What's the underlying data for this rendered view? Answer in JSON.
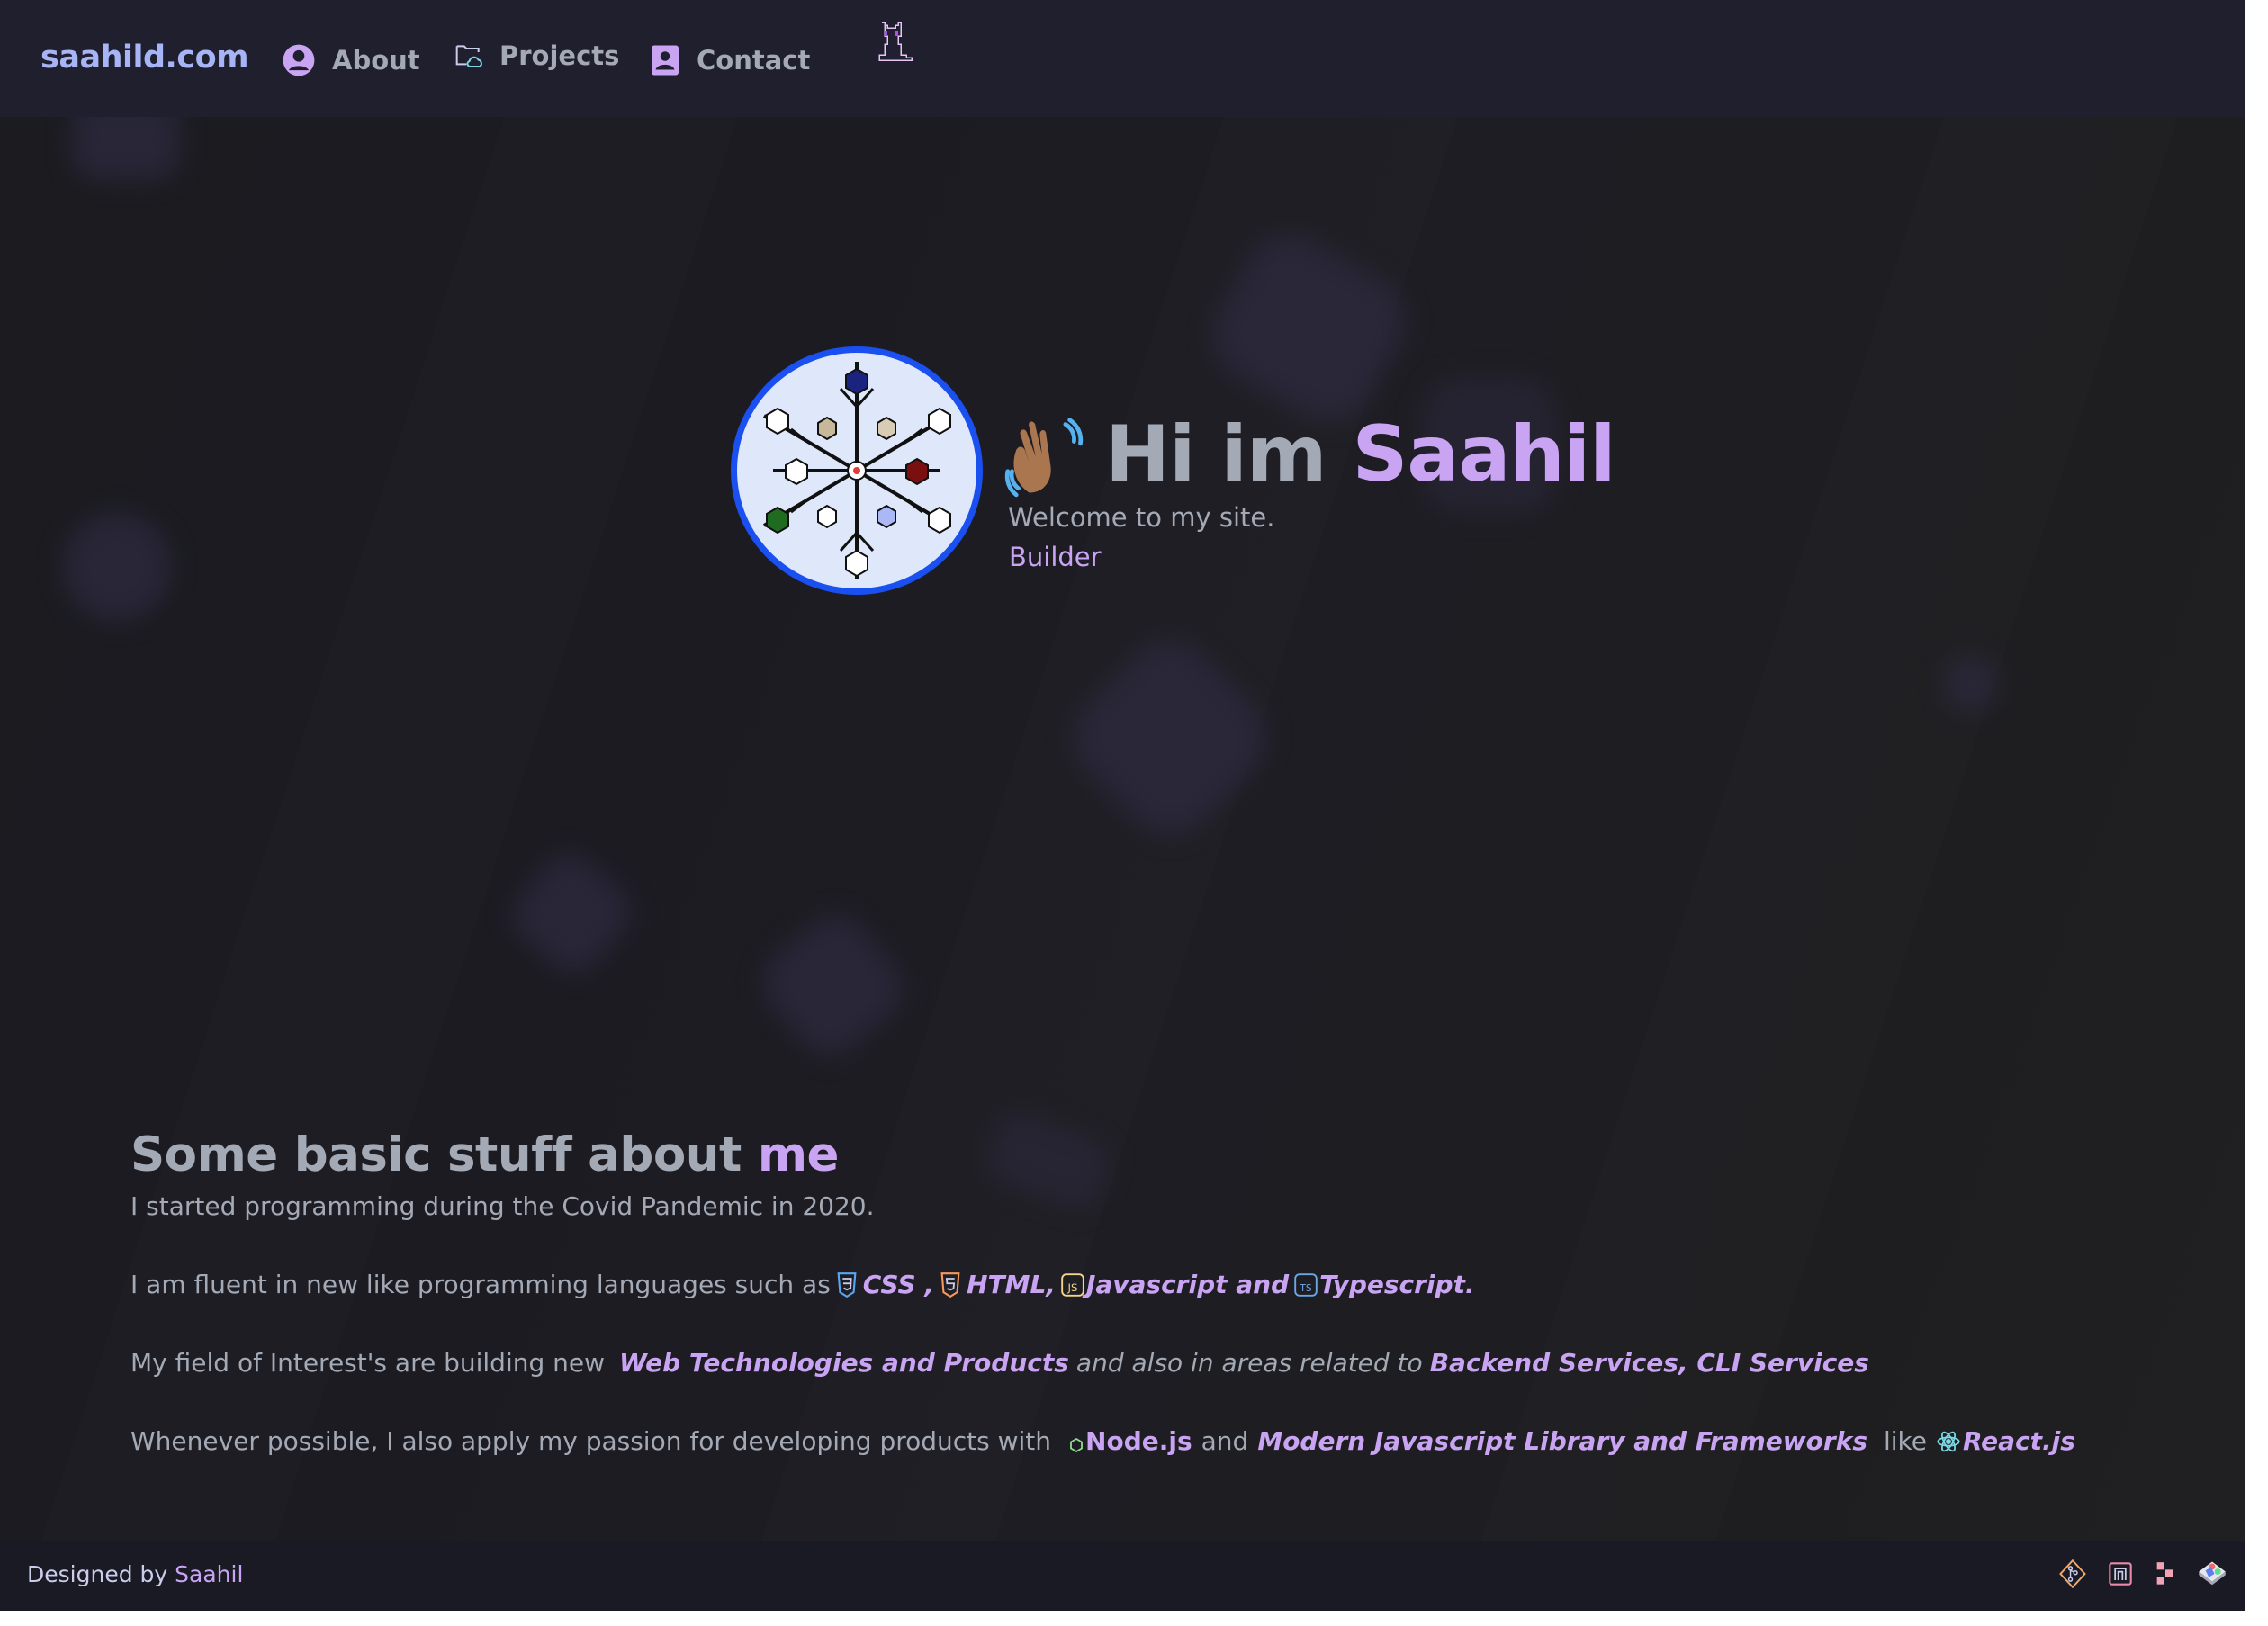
{
  "nav": {
    "logo": "saahild.com",
    "items": [
      {
        "label": "About",
        "icon": "user-circle-icon"
      },
      {
        "label": "Projects",
        "icon": "folder-cloud-icon"
      },
      {
        "label": "Contact",
        "icon": "contact-card-icon"
      }
    ],
    "mascot": "pixel-cat-icon"
  },
  "hero": {
    "wave_emoji": "waving-hand-icon",
    "greeting": "Hi im",
    "name": "Saahil",
    "welcome": "Welcome to my site.",
    "role": "Builder",
    "avatar": "snowflake-tech-avatar"
  },
  "about": {
    "title_prefix": "Some basic stuff about",
    "title_accent": "me",
    "p1": "I started programming during the Covid Pandemic in 2020.",
    "p2": {
      "intro": "I am fluent in new like programming languages such as",
      "css": "CSS ,",
      "html": "HTML,",
      "js": "Javascript and",
      "ts": "Typescript."
    },
    "p3": {
      "intro": "My field of Interest's are building new",
      "web": "Web Technologies and Products",
      "mid": "and also in areas related to",
      "backend": "Backend Services, CLI Services"
    },
    "p4": {
      "intro": "Whenever possible, I also apply my passion for developing products with",
      "node": "Node.js",
      "and": "and",
      "frameworks": "Modern Javascript Library and Frameworks",
      "like": "like",
      "react": "React.js"
    }
  },
  "footer": {
    "designed_by": "Designed by",
    "author": "Saahil",
    "icons": [
      "git-icon",
      "nuxt-icon",
      "tech-logo-icon",
      "stack-icon"
    ]
  },
  "colors": {
    "accent": "#c9a4f3",
    "logo": "#a7b4f5",
    "text": "#a3a9b5",
    "nav_bg": "#1f1f2e",
    "footer_bg": "#1a1a24",
    "page_bg": "#1c1c21"
  }
}
